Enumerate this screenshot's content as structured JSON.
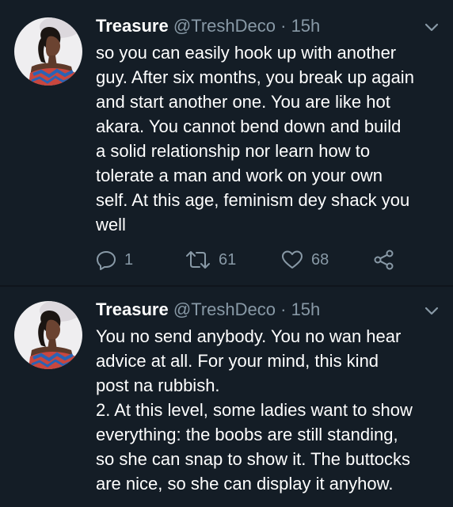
{
  "colors": {
    "background": "#141d26",
    "text": "#ffffff",
    "secondary": "#8899a6",
    "divider": "#0f151c"
  },
  "tweets": [
    {
      "display_name": "Treasure",
      "handle": "@TreshDeco",
      "separator": "·",
      "time": "15h",
      "text": "so you can easily hook up with another\nguy. After six months, you break up again\nand start another one. You are like hot\nakara. You cannot bend down and build\na solid relationship nor learn how to\ntolerate a man and work on your own\nself. At this age, feminism dey shack you\nwell",
      "reply_count": "1",
      "retweet_count": "61",
      "like_count": "68"
    },
    {
      "display_name": "Treasure",
      "handle": "@TreshDeco",
      "separator": "·",
      "time": "15h",
      "text": "You no send anybody. You no wan hear\nadvice at all. For your mind, this kind\npost na rubbish.\n2. At this level, some ladies want to show\neverything: the boobs are still standing,\nso she can snap to show it. The buttocks\nare nice, so she can display it anyhow."
    }
  ],
  "icons": {
    "avatar": "profile-photo",
    "caret": "chevron-down-icon",
    "reply": "reply-icon",
    "retweet": "retweet-icon",
    "like": "heart-icon",
    "share": "share-icon"
  }
}
